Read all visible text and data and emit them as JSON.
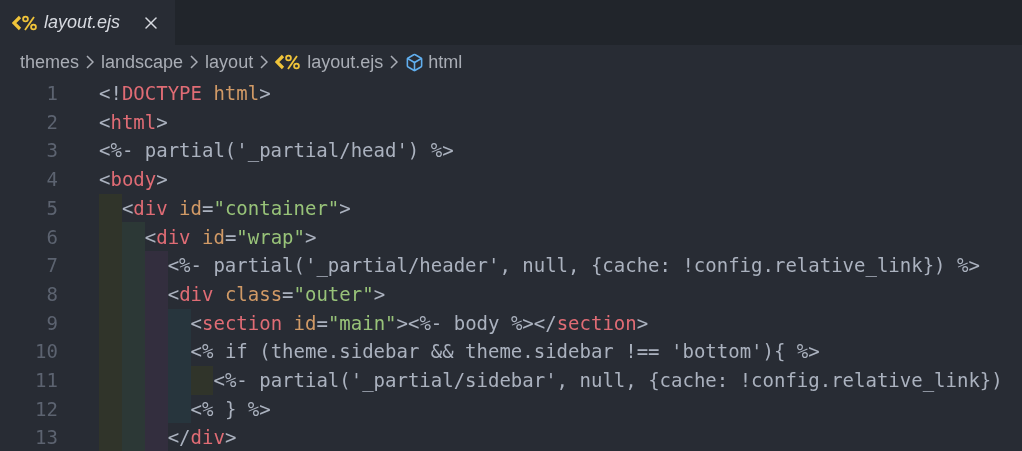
{
  "tab": {
    "title": "layout.ejs"
  },
  "breadcrumb": [
    {
      "label": "themes",
      "kind": "folder"
    },
    {
      "label": "landscape",
      "kind": "folder"
    },
    {
      "label": "layout",
      "kind": "folder"
    },
    {
      "label": "layout.ejs",
      "kind": "file"
    },
    {
      "label": "html",
      "kind": "symbol"
    }
  ],
  "lines": [
    {
      "number": "1",
      "tokens": [
        {
          "text": "<!",
          "kind": "punct"
        },
        {
          "text": "DOCTYPE",
          "kind": "tag"
        },
        {
          "text": " html",
          "kind": "attr"
        },
        {
          "text": ">",
          "kind": "punct"
        }
      ]
    },
    {
      "number": "2",
      "tokens": [
        {
          "text": "<",
          "kind": "punct"
        },
        {
          "text": "html",
          "kind": "tag"
        },
        {
          "text": ">",
          "kind": "punct"
        }
      ]
    },
    {
      "number": "3",
      "tokens": [
        {
          "text": "<%- partial('_partial/head') %>",
          "kind": "plain"
        }
      ]
    },
    {
      "number": "4",
      "tokens": [
        {
          "text": "<",
          "kind": "punct"
        },
        {
          "text": "body",
          "kind": "tag"
        },
        {
          "text": ">",
          "kind": "punct"
        }
      ]
    },
    {
      "number": "5",
      "tokens": [
        {
          "text": "  <",
          "kind": "punct"
        },
        {
          "text": "div",
          "kind": "tag"
        },
        {
          "text": " id",
          "kind": "attr"
        },
        {
          "text": "=",
          "kind": "punct"
        },
        {
          "text": "\"container\"",
          "kind": "string"
        },
        {
          "text": ">",
          "kind": "punct"
        }
      ]
    },
    {
      "number": "6",
      "tokens": [
        {
          "text": "    <",
          "kind": "punct"
        },
        {
          "text": "div",
          "kind": "tag"
        },
        {
          "text": " id",
          "kind": "attr"
        },
        {
          "text": "=",
          "kind": "punct"
        },
        {
          "text": "\"wrap\"",
          "kind": "string"
        },
        {
          "text": ">",
          "kind": "punct"
        }
      ]
    },
    {
      "number": "7",
      "tokens": [
        {
          "text": "      <%- partial('_partial/header', null, {cache: !config.relative_link}) %>",
          "kind": "plain"
        }
      ]
    },
    {
      "number": "8",
      "tokens": [
        {
          "text": "      <",
          "kind": "punct"
        },
        {
          "text": "div",
          "kind": "tag"
        },
        {
          "text": " class",
          "kind": "attr"
        },
        {
          "text": "=",
          "kind": "punct"
        },
        {
          "text": "\"outer\"",
          "kind": "string"
        },
        {
          "text": ">",
          "kind": "punct"
        }
      ]
    },
    {
      "number": "9",
      "tokens": [
        {
          "text": "        <",
          "kind": "punct"
        },
        {
          "text": "section",
          "kind": "tag"
        },
        {
          "text": " id",
          "kind": "attr"
        },
        {
          "text": "=",
          "kind": "punct"
        },
        {
          "text": "\"main\"",
          "kind": "string"
        },
        {
          "text": "><%- body %></",
          "kind": "punct"
        },
        {
          "text": "section",
          "kind": "tag"
        },
        {
          "text": ">",
          "kind": "punct"
        }
      ]
    },
    {
      "number": "10",
      "tokens": [
        {
          "text": "        <% if (theme.sidebar && theme.sidebar !== 'bottom'){ %>",
          "kind": "plain"
        }
      ]
    },
    {
      "number": "11",
      "tokens": [
        {
          "text": "          <%- partial('_partial/sidebar', null, {cache: !config.relative_link})",
          "kind": "plain"
        }
      ]
    },
    {
      "number": "12",
      "tokens": [
        {
          "text": "        <% } %>",
          "kind": "plain"
        }
      ]
    },
    {
      "number": "13",
      "tokens": [
        {
          "text": "      </",
          "kind": "punct"
        },
        {
          "text": "div",
          "kind": "tag"
        },
        {
          "text": ">",
          "kind": "punct"
        }
      ]
    }
  ]
}
